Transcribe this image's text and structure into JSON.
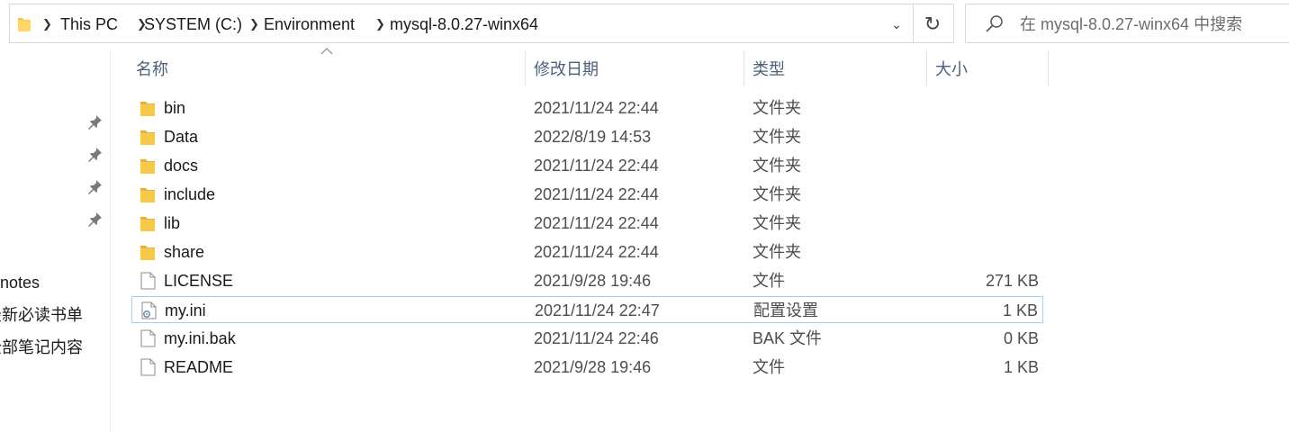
{
  "breadcrumb": {
    "items": [
      "This PC",
      "SYSTEM (C:)",
      "Environment",
      "mysql-8.0.27-winx64"
    ]
  },
  "search": {
    "placeholder": "在 mysql-8.0.27-winx64 中搜索"
  },
  "nav": {
    "items": [
      "notes",
      "最新必读书单",
      "全部笔记内容"
    ]
  },
  "columns": {
    "name": "名称",
    "date": "修改日期",
    "type": "类型",
    "size": "大小"
  },
  "files": [
    {
      "name": "bin",
      "date": "2021/11/24 22:44",
      "type": "文件夹",
      "size": "",
      "icon": "folder-icon"
    },
    {
      "name": "Data",
      "date": "2022/8/19 14:53",
      "type": "文件夹",
      "size": "",
      "icon": "folder-icon"
    },
    {
      "name": "docs",
      "date": "2021/11/24 22:44",
      "type": "文件夹",
      "size": "",
      "icon": "folder-icon"
    },
    {
      "name": "include",
      "date": "2021/11/24 22:44",
      "type": "文件夹",
      "size": "",
      "icon": "folder-icon"
    },
    {
      "name": "lib",
      "date": "2021/11/24 22:44",
      "type": "文件夹",
      "size": "",
      "icon": "folder-icon"
    },
    {
      "name": "share",
      "date": "2021/11/24 22:44",
      "type": "文件夹",
      "size": "",
      "icon": "folder-icon"
    },
    {
      "name": "LICENSE",
      "date": "2021/9/28 19:46",
      "type": "文件",
      "size": "271 KB",
      "icon": "file-icon"
    },
    {
      "name": "my.ini",
      "date": "2021/11/24 22:47",
      "type": "配置设置",
      "size": "1 KB",
      "icon": "config-file-icon"
    },
    {
      "name": "my.ini.bak",
      "date": "2021/11/24 22:46",
      "type": "BAK 文件",
      "size": "0 KB",
      "icon": "file-icon"
    },
    {
      "name": "README",
      "date": "2021/9/28 19:46",
      "type": "文件",
      "size": "1 KB",
      "icon": "file-icon"
    }
  ],
  "colors": {
    "folder": "#f8c948",
    "header_text": "#4c607a",
    "selection_border": "#99d1ff"
  }
}
